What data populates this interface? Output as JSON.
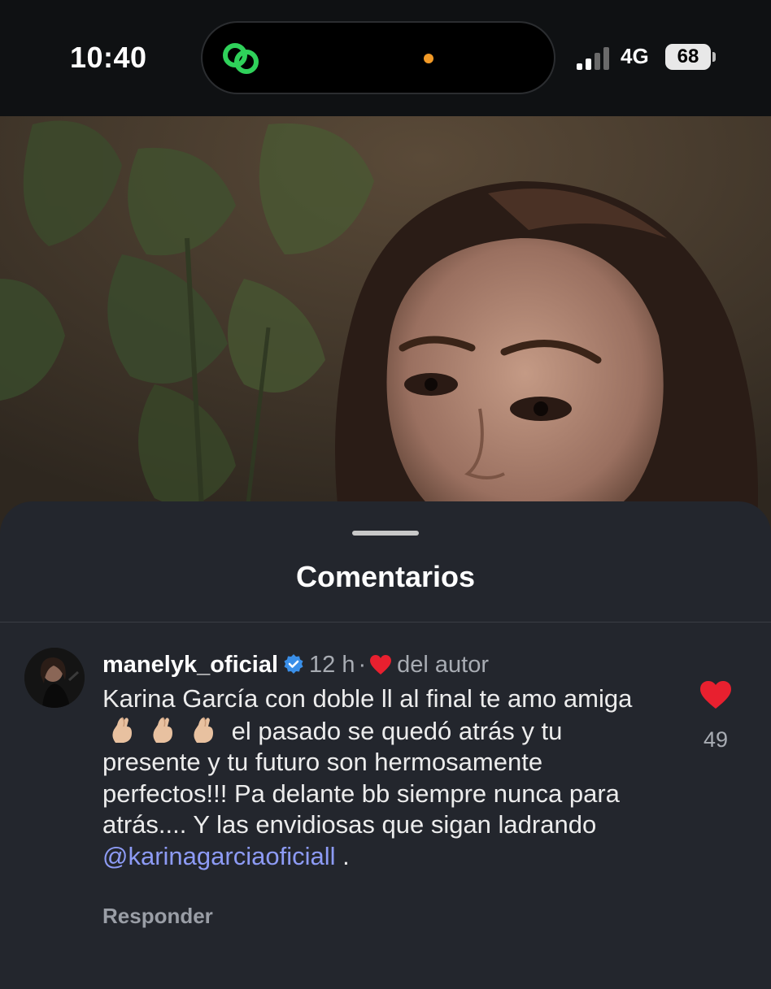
{
  "status_bar": {
    "time": "10:40",
    "network": "4G",
    "battery": "68",
    "app_indicator_icon": "link-chain-icon",
    "dot_color": "#f29a27"
  },
  "sheet": {
    "title": "Comentarios"
  },
  "comment": {
    "username": "manelyk_oficial",
    "verified": true,
    "time_ago": "12 h",
    "separator": "·",
    "author_label": "del autor",
    "text_part1": "Karina García con doble ll al final te amo amiga",
    "emoji": "🤞🏼",
    "text_part2": "el pasado se quedó atrás y tu presente y tu futuro son hermosamente perfectos!!! Pa delante bb siempre nunca para atrás.... Y las envidiosas que sigan ladrando",
    "mention": "@karinagarciaoficiall",
    "text_end": ".",
    "likes": "49",
    "reply_label": "Responder"
  },
  "colors": {
    "sheet_bg": "#23262d",
    "heart": "#e8202f",
    "mention": "#8d9bf5",
    "verified": "#3a8fe8"
  }
}
